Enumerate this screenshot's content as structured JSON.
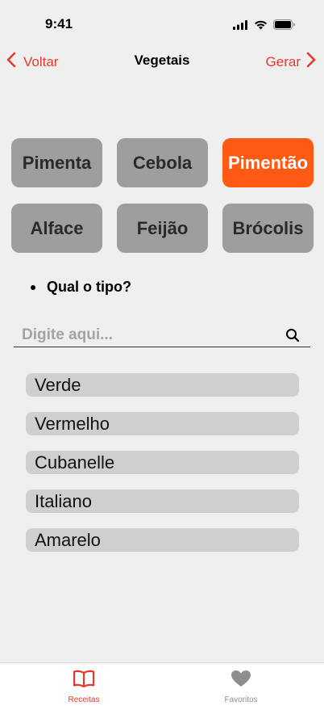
{
  "status_bar": {
    "time": "9:41"
  },
  "nav": {
    "back_label": "Voltar",
    "title": "Vegetais",
    "forward_label": "Gerar"
  },
  "vegetables": [
    {
      "label": "Pimenta",
      "selected": false
    },
    {
      "label": "Cebola",
      "selected": false
    },
    {
      "label": "Pimentão",
      "selected": true
    },
    {
      "label": "Alface",
      "selected": false
    },
    {
      "label": "Feijão",
      "selected": false
    },
    {
      "label": "Brócolis",
      "selected": false
    }
  ],
  "question": "Qual o tipo?",
  "search": {
    "placeholder": "Digite aqui...",
    "value": ""
  },
  "types": [
    "Verde",
    "Vermelho",
    "Cubanelle",
    "Italiano",
    "Amarelo"
  ],
  "tab_bar": {
    "tabs": [
      {
        "label": "Receitas",
        "icon": "book-icon",
        "active": true
      },
      {
        "label": "Favoritos",
        "icon": "heart-icon",
        "active": false
      }
    ]
  },
  "colors": {
    "accent": "#e8392f",
    "selected_chip": "#ff5a13",
    "chip": "#9e9e9e",
    "list_item": "#cfcfcf",
    "background": "#efefef"
  }
}
